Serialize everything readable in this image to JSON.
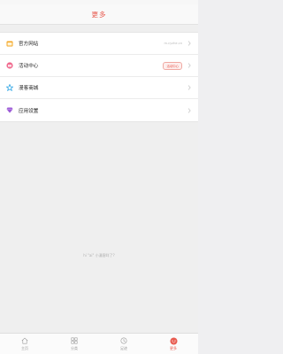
{
  "header": {
    "title": "更多"
  },
  "menu": [
    {
      "label": "官方网站",
      "value": "m.cyzhe.cn",
      "badge": "",
      "icon": "browser-icon",
      "icon_color": "#f5a623"
    },
    {
      "label": "活动中心",
      "value": "",
      "badge": "活动中心",
      "icon": "gift-icon",
      "icon_color": "#f06a8e"
    },
    {
      "label": "漫客商城",
      "value": "",
      "badge": "",
      "icon": "star-icon",
      "icon_color": "#2fa6e6"
    },
    {
      "label": "应用设置",
      "value": "",
      "badge": "",
      "icon": "gem-icon",
      "icon_color": "#9b59d6"
    }
  ],
  "footer_note": "hi \"ai\" 小漫客咩了?",
  "tabs": [
    {
      "label": "主页",
      "icon": "home-icon",
      "active": false
    },
    {
      "label": "分类",
      "icon": "grid-icon",
      "active": false
    },
    {
      "label": "足迹",
      "icon": "footprint-icon",
      "active": false
    },
    {
      "label": "更多",
      "icon": "more-icon",
      "active": true
    }
  ],
  "colors": {
    "accent": "#e85a4f",
    "background": "#efefef"
  }
}
